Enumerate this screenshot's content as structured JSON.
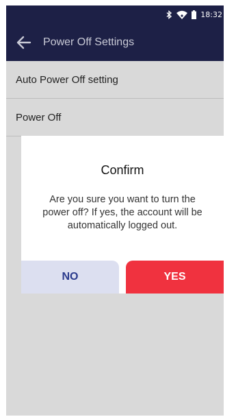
{
  "status_bar": {
    "time": "18:32",
    "icons": [
      "bluetooth-icon",
      "wifi-icon",
      "battery-icon"
    ]
  },
  "app_bar": {
    "title": "Power Off Settings",
    "back_icon": "arrow-left-icon"
  },
  "settings": {
    "items": [
      {
        "label": "Auto Power Off setting"
      },
      {
        "label": "Power Off"
      }
    ]
  },
  "dialog": {
    "title": "Confirm",
    "message": "Are you sure you want to turn the power off? If yes, the account will be automatically logged out.",
    "no_label": "NO",
    "yes_label": "YES"
  },
  "colors": {
    "header": "#1d2046",
    "screen_background": "#d9d9d9",
    "no_button": "#dcdff0",
    "no_text": "#2a3a8c",
    "yes_button": "#f0323f"
  }
}
